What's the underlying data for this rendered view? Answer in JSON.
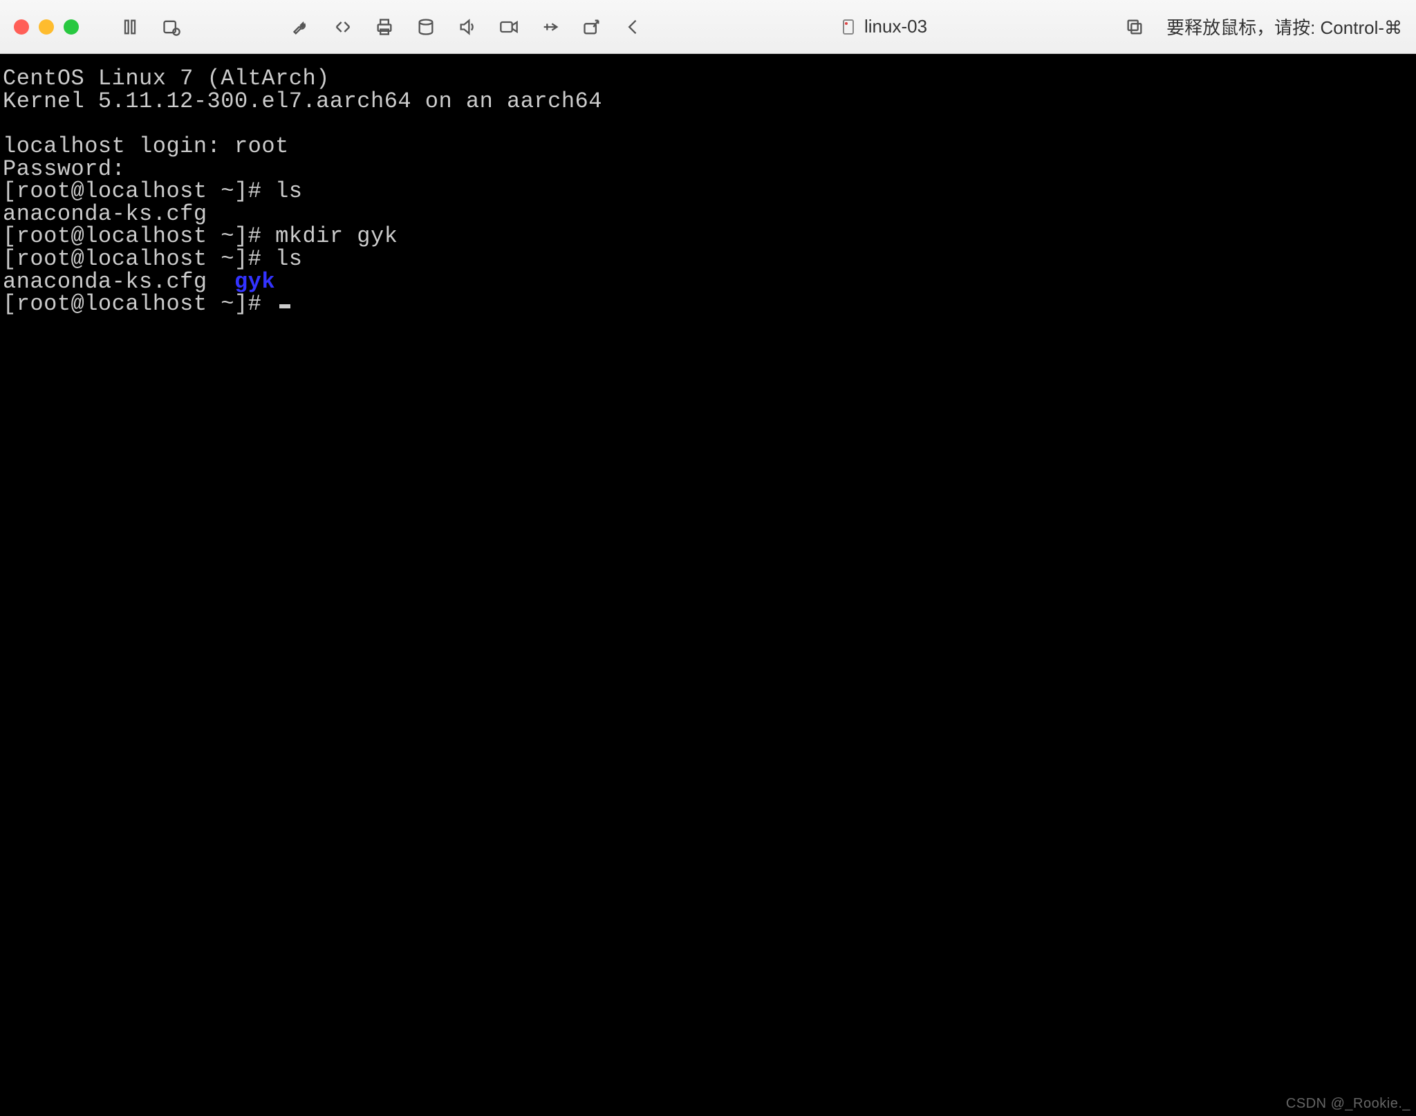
{
  "window": {
    "title": "linux-03",
    "hint": "要释放鼠标，请按: Control-⌘"
  },
  "terminal": {
    "banner1": "CentOS Linux 7 (AltArch)",
    "banner2": "Kernel 5.11.12-300.el7.aarch64 on an aarch64",
    "login_prompt": "localhost login: root",
    "password_prompt": "Password:",
    "prompt1": "[root@localhost ~]# ls",
    "output1": "anaconda-ks.cfg",
    "prompt2": "[root@localhost ~]# mkdir gyk",
    "prompt3": "[root@localhost ~]# ls",
    "output2_file": "anaconda-ks.cfg  ",
    "output2_dir": "gyk",
    "prompt4": "[root@localhost ~]# "
  },
  "watermark": "CSDN @_Rookie._"
}
